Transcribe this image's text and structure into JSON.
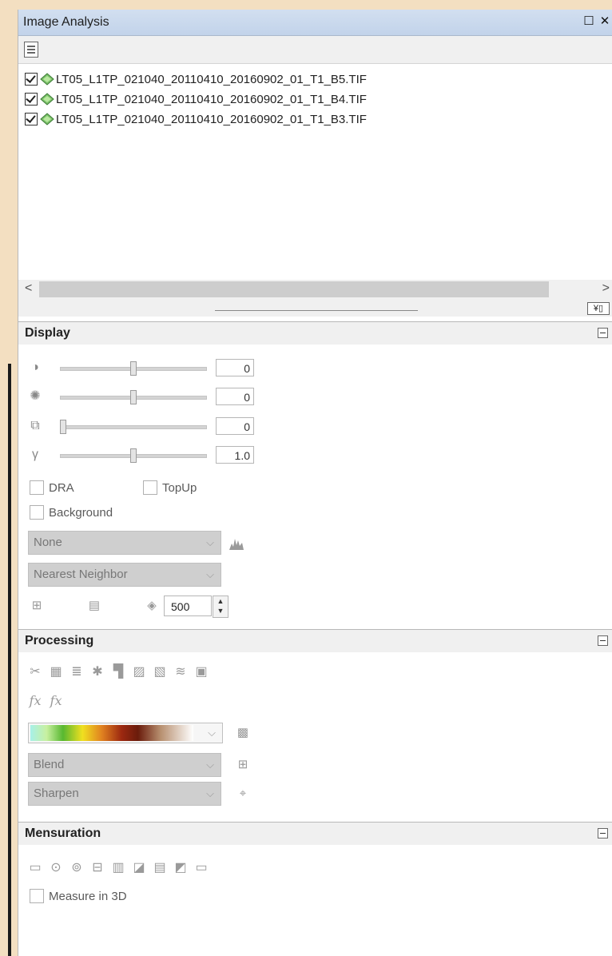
{
  "window": {
    "title": "Image Analysis",
    "restore_glyph": "☐",
    "close_glyph": "✕"
  },
  "toolbar": {
    "list_options_icon": "list-options-icon"
  },
  "layers": [
    {
      "name": "LT05_L1TP_021040_20110410_20160902_01_T1_B5.TIF",
      "checked": true
    },
    {
      "name": "LT05_L1TP_021040_20110410_20160902_01_T1_B4.TIF",
      "checked": true
    },
    {
      "name": "LT05_L1TP_021040_20110410_20160902_01_T1_B3.TIF",
      "checked": true
    }
  ],
  "scroll": {
    "left_arrow": "<",
    "right_arrow": ">"
  },
  "splitter": {
    "button_glyph": "¥▯"
  },
  "display": {
    "header": "Display",
    "sliders": [
      {
        "icon": "contrast-icon",
        "glyph": "◑",
        "value": "0",
        "level": 0.5
      },
      {
        "icon": "brightness-icon",
        "glyph": "✺",
        "value": "0",
        "level": 0.5
      },
      {
        "icon": "transparency-icon",
        "glyph": "⧉",
        "value": "0",
        "level": 0.0
      },
      {
        "icon": "gamma-icon",
        "glyph": "γ",
        "value": "1.0",
        "level": 0.5
      }
    ],
    "dra_label": "DRA",
    "topup_label": "TopUp",
    "background_label": "Background",
    "stretch_value": "None",
    "resample_value": "Nearest Neighbor",
    "scale_value": "500"
  },
  "processing": {
    "header": "Processing",
    "tools": [
      "clip-icon",
      "mask-icon",
      "stack-icon",
      "ndvi-icon",
      "composite-icon",
      "orthorectify-icon",
      "hillshade-icon",
      "shaded-relief-icon",
      "save-icon"
    ],
    "function_icons": [
      "function-icon",
      "function-template-icon"
    ],
    "blend_value": "Blend",
    "sharpen_value": "Sharpen"
  },
  "mensuration": {
    "header": "Mensuration",
    "tools": [
      "distance-icon",
      "point-icon",
      "centroid-icon",
      "height-base-top-icon",
      "height-top-shadow-icon",
      "height-base-shadow-icon",
      "area-icon",
      "perimeter-icon",
      "measure-options-icon"
    ],
    "measure3d_label": "Measure in 3D"
  },
  "colors": {
    "panel_bg": "#ffffff",
    "title_bar": "#c9d8ec",
    "section_bg": "#f0f0f0",
    "frame_bg": "#f3dfc1"
  }
}
